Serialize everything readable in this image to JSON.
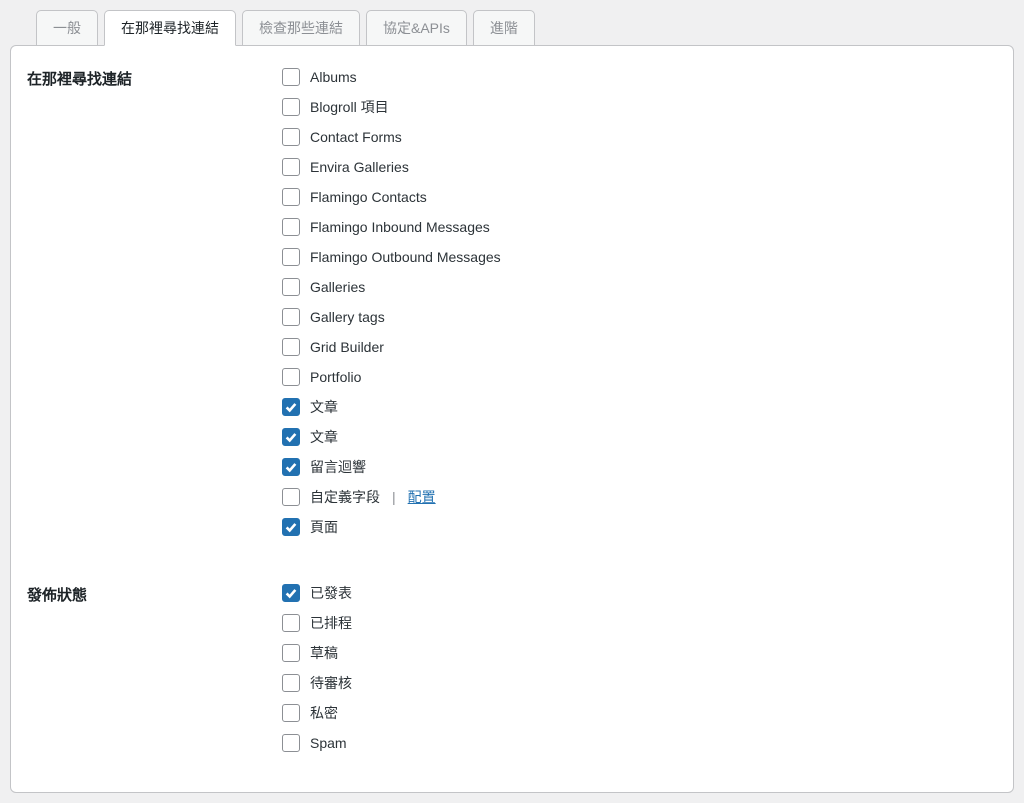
{
  "tabs": [
    {
      "label": "一般"
    },
    {
      "label": "在那裡尋找連結"
    },
    {
      "label": "檢查那些連結"
    },
    {
      "label": "協定&APIs"
    },
    {
      "label": "進階"
    }
  ],
  "section1": {
    "title": "在那裡尋找連結",
    "items": [
      {
        "label": "Albums",
        "checked": false
      },
      {
        "label": "Blogroll 項目",
        "checked": false
      },
      {
        "label": "Contact Forms",
        "checked": false
      },
      {
        "label": "Envira Galleries",
        "checked": false
      },
      {
        "label": "Flamingo Contacts",
        "checked": false
      },
      {
        "label": "Flamingo Inbound Messages",
        "checked": false
      },
      {
        "label": "Flamingo Outbound Messages",
        "checked": false
      },
      {
        "label": "Galleries",
        "checked": false
      },
      {
        "label": "Gallery tags",
        "checked": false
      },
      {
        "label": "Grid Builder",
        "checked": false
      },
      {
        "label": "Portfolio",
        "checked": false
      },
      {
        "label": "文章",
        "checked": true
      },
      {
        "label": "文章",
        "checked": true
      },
      {
        "label": "留言迴響",
        "checked": true
      },
      {
        "label": "自定義字段",
        "checked": false,
        "separator": "|",
        "link": "配置"
      },
      {
        "label": "頁面",
        "checked": true
      }
    ]
  },
  "section2": {
    "title": "發佈狀態",
    "items": [
      {
        "label": "已發表",
        "checked": true
      },
      {
        "label": "已排程",
        "checked": false
      },
      {
        "label": "草稿",
        "checked": false
      },
      {
        "label": "待審核",
        "checked": false
      },
      {
        "label": "私密",
        "checked": false
      },
      {
        "label": "Spam",
        "checked": false
      }
    ]
  }
}
